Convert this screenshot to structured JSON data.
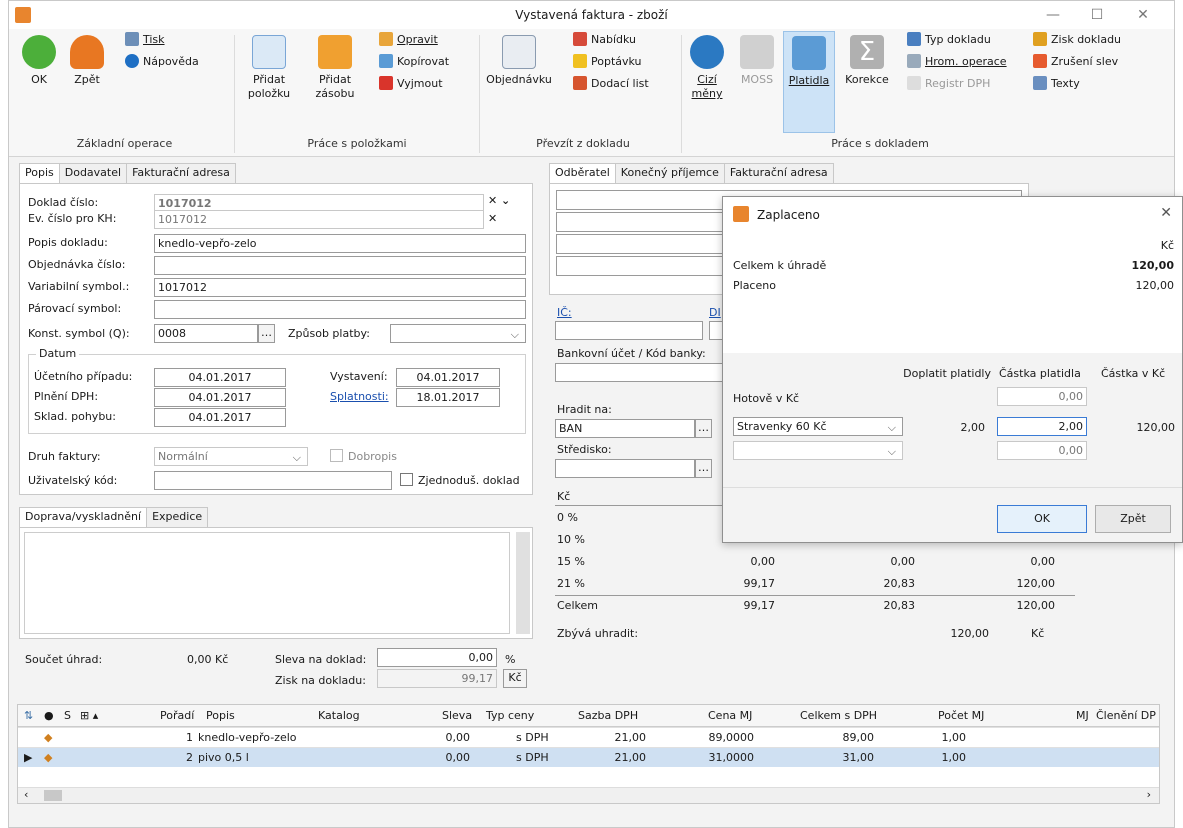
{
  "window": {
    "title": "Vystavená faktura - zboží"
  },
  "ribbon": {
    "ok": "OK",
    "back": "Zpět",
    "print": "Tisk",
    "help": "Nápověda",
    "grp_basic": "Základní operace",
    "add_item": "Přidat položku",
    "add_stock": "Přidat zásobu",
    "edit": "Opravit",
    "copy": "Kopírovat",
    "cut": "Vyjmout",
    "grp_items": "Práce s položkami",
    "order": "Objednávku",
    "offer": "Nabídku",
    "demand": "Poptávku",
    "delivery": "Dodací list",
    "grp_transfer": "Převzít z dokladu",
    "foreign": "Cizí měny",
    "moss": "MOSS",
    "payments": "Platidla",
    "correction": "Korekce",
    "doc_type": "Typ dokladu",
    "bulk": "Hrom. operace",
    "vat_reg": "Registr DPH",
    "profit": "Zisk dokladu",
    "cancel_disc": "Zrušení slev",
    "texts": "Texty",
    "grp_doc": "Práce s dokladem"
  },
  "left": {
    "tabs": [
      "Popis",
      "Dodavatel",
      "Fakturační adresa"
    ],
    "doc_no_label": "Doklad číslo:",
    "doc_no": "1017012",
    "ev_label": "Ev. číslo pro KH:",
    "ev": "1017012",
    "desc_label": "Popis dokladu:",
    "desc": "knedlo-vepřo-zelo",
    "order_label": "Objednávka číslo:",
    "order": "",
    "var_label": "Variabilní symbol.:",
    "var": "1017012",
    "pair_label": "Párovací symbol:",
    "pair": "",
    "const_label": "Konst. symbol (Q):",
    "const": "0008",
    "pay_label": "Způsob platby:",
    "pay": "",
    "date_group": "Datum",
    "case_label": "Účetního případu:",
    "case": "04.01.2017",
    "issue_label": "Vystavení:",
    "issue": "04.01.2017",
    "vat_label": "Plnění DPH:",
    "vat": "04.01.2017",
    "due_label": "Splatnosti:",
    "due": "18.01.2017",
    "stock_label": "Sklad. pohybu:",
    "stock": "04.01.2017",
    "kind_label": "Druh faktury:",
    "kind": "Normální",
    "credit_label": "Dobropis",
    "user_label": "Uživatelský kód:",
    "user": "",
    "simple_label": "Zjednoduš. doklad",
    "tabs2": [
      "Doprava/vyskladnění",
      "Expedice"
    ],
    "sum_label": "Součet úhrad:",
    "sum": "0,00 Kč",
    "disc_label": "Sleva na doklad:",
    "disc": "0,00",
    "pct": "%",
    "profit_label": "Zisk na dokladu:",
    "profit": "99,17",
    "kc": "Kč"
  },
  "right": {
    "tabs": [
      "Odběratel",
      "Konečný příjemce",
      "Fakturační adresa"
    ],
    "ic": "IČ:",
    "dic": "DI",
    "bank_label": "Bankovní účet / Kód banky:",
    "pay_label": "Hradit na:",
    "pay": "BAN",
    "center_label": "Středisko:",
    "kc": "Kč",
    "rates": [
      {
        "r": "0 %",
        "a": "",
        "b": "",
        "c": ""
      },
      {
        "r": "10 %",
        "a": "",
        "b": "",
        "c": ""
      },
      {
        "r": "15 %",
        "a": "0,00",
        "b": "0,00",
        "c": "0,00"
      },
      {
        "r": "21 %",
        "a": "99,17",
        "b": "20,83",
        "c": "120,00"
      }
    ],
    "total_label": "Celkem",
    "total_a": "99,17",
    "total_b": "20,83",
    "total_c": "120,00",
    "remain_label": "Zbývá uhradit:",
    "remain": "120,00",
    "remain_cur": "Kč"
  },
  "dialog": {
    "title": "Zaplaceno",
    "currency": "Kč",
    "total_label": "Celkem k úhradě",
    "total": "120,00",
    "paid_label": "Placeno",
    "paid": "120,00",
    "col1": "Doplatit platidly",
    "col2": "Částka platidla",
    "col3": "Částka v Kč",
    "cash_label": "Hotově v Kč",
    "cash": "0,00",
    "row1_sel": "Stravenky 60 Kč",
    "row1_qty": "2,00",
    "row1_amt": "2,00",
    "row1_kc": "120,00",
    "row2_sel": "",
    "row2_amt": "0,00",
    "ok": "OK",
    "back": "Zpět"
  },
  "grid": {
    "headers": [
      "S",
      "Pořadí",
      "Popis",
      "Katalog",
      "Sleva",
      "Typ ceny",
      "Sazba DPH",
      "Cena MJ",
      "Celkem s DPH",
      "Počet MJ",
      "MJ",
      "Členění DP"
    ],
    "rows": [
      {
        "no": "1",
        "desc": "knedlo-vepřo-zelo",
        "disc": "0,00",
        "type": "s DPH",
        "vat": "21,00",
        "price": "89,0000",
        "total": "89,00",
        "qty": "1,00"
      },
      {
        "no": "2",
        "desc": "pivo 0,5 l",
        "disc": "0,00",
        "type": "s DPH",
        "vat": "21,00",
        "price": "31,0000",
        "total": "31,00",
        "qty": "1,00"
      }
    ]
  },
  "colors": {
    "accent": "#cde3f7",
    "selected": "#cfe0f2"
  }
}
